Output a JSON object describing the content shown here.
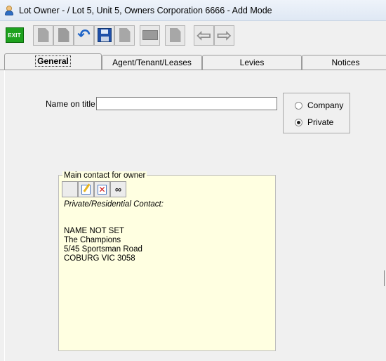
{
  "window": {
    "title": "Lot Owner -  / Lot 5, Unit 5, Owners Corporation 6666 - Add Mode"
  },
  "toolbar": {
    "exit_label": "EXIT",
    "buttons": [
      "exit-icon",
      "new-document-icon",
      "copy-document-icon",
      "undo-icon",
      "save-icon",
      "print-document-icon",
      "calculator-icon",
      "delete-document-icon",
      "arrow-left-icon",
      "arrow-right-icon"
    ]
  },
  "tabs": [
    {
      "label": "General",
      "active": true
    },
    {
      "label": "Agent/Tenant/Leases",
      "active": false
    },
    {
      "label": "Levies",
      "active": false
    },
    {
      "label": "Notices",
      "active": false
    }
  ],
  "general": {
    "name_on_title_label": "Name on title",
    "name_on_title_value": "",
    "owner_type": {
      "options": [
        "Company",
        "Private"
      ],
      "selected": "Private"
    }
  },
  "contact": {
    "group_label": "Main contact for owner",
    "type_label": "Private/Residential Contact:",
    "lines": [
      "NAME NOT SET",
      "The Champions",
      "5/45 Sportsman Road",
      "COBURG  VIC  3058"
    ]
  },
  "colors": {
    "contact_background": "#ffffe1",
    "exit_button": "#1ea21e",
    "undo_icon": "#1d63c7",
    "save_icon": "#1f4fa8"
  }
}
